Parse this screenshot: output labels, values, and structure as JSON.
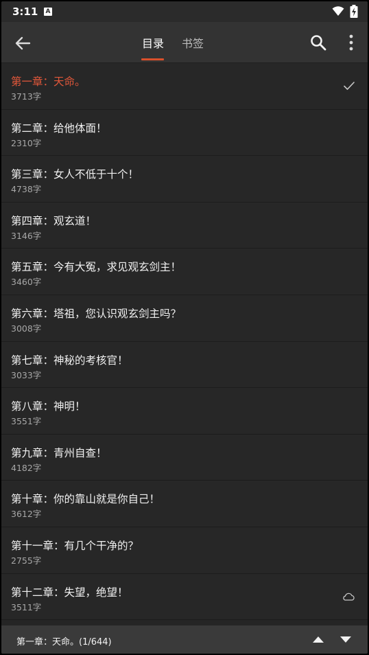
{
  "status_bar": {
    "time": "3:11",
    "notification_glyph": "A"
  },
  "app_bar": {
    "tabs": [
      {
        "label": "目录",
        "active": true
      },
      {
        "label": "书签",
        "active": false
      }
    ]
  },
  "chapters": [
    {
      "title": "第一章：天命。",
      "count": "3713字",
      "current": true,
      "icon": "check-icon"
    },
    {
      "title": "第二章：给他体面！",
      "count": "2310字"
    },
    {
      "title": "第三章：女人不低于十个！",
      "count": "4738字"
    },
    {
      "title": "第四章：观玄道！",
      "count": "3146字"
    },
    {
      "title": "第五章：今有大冤，求见观玄剑主！",
      "count": "3460字"
    },
    {
      "title": "第六章：塔祖，您认识观玄剑主吗？",
      "count": "3008字"
    },
    {
      "title": "第七章：神秘的考核官！",
      "count": "3033字"
    },
    {
      "title": "第八章：神明！",
      "count": "3551字"
    },
    {
      "title": "第九章：青州自查！",
      "count": "4182字"
    },
    {
      "title": "第十章：你的靠山就是你自己！",
      "count": "3612字"
    },
    {
      "title": "第十一章：有几个干净的？",
      "count": "2755字"
    },
    {
      "title": "第十二章：失望，绝望！",
      "count": "3511字",
      "icon": "cloud-icon"
    }
  ],
  "bottom_bar": {
    "current_chapter": "第一章：天命。",
    "position": "(1/644)"
  },
  "colors": {
    "accent": "#d9502c",
    "current_title": "#e0573a",
    "background": "#252525",
    "app_bar": "#333333"
  }
}
